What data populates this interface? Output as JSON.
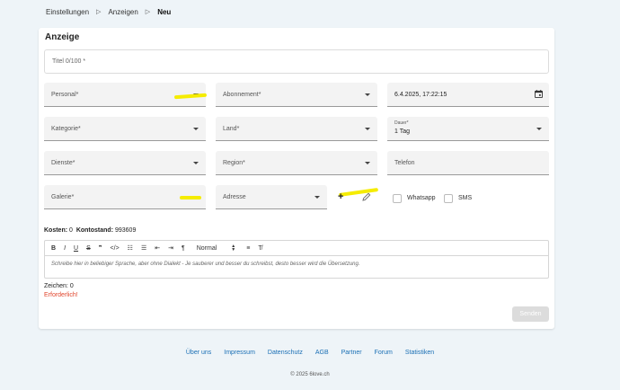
{
  "breadcrumb": {
    "items": [
      "Einstellungen",
      "Anzeigen",
      "Neu"
    ],
    "separator": "▷"
  },
  "card": {
    "title": "Anzeige"
  },
  "form": {
    "title_placeholder": "Titel 0/100 *",
    "personal": "Personal*",
    "abonnement": "Abonnement*",
    "datetime": "6.4.2025, 17:22:15",
    "kategorie": "Kategorie*",
    "land": "Land*",
    "dauer_label": "Dauer*",
    "dauer_value": "1 Tag",
    "dienste": "Dienste*",
    "region": "Region*",
    "telefon": "Telefon",
    "galerie": "Galerie*",
    "adresse": "Adresse",
    "whatsapp": "Whatsapp",
    "sms": "SMS"
  },
  "costs": {
    "kosten_label": "Kosten:",
    "kosten_value": "0",
    "kontostand_label": "Kontostand:",
    "kontostand_value": "993609"
  },
  "editor": {
    "toolbar": {
      "bold": "B",
      "italic": "I",
      "underline": "U",
      "strike": "S",
      "quote": "❞",
      "code": "</>",
      "ordered_list": "☷",
      "bullet_list": "☰",
      "outdent": "⇤",
      "indent": "⇥",
      "pilcrow": "¶",
      "format": "Normal",
      "align": "≡",
      "clear": "T̸"
    },
    "placeholder": "Schreibe hier in beliebiger Sprache, aber ohne Dialekt - Je sauberer und besser du schreibst, desto besser wird die Übersetzung."
  },
  "chars": {
    "label": "Zeichen:",
    "value": "0"
  },
  "required_text": "Erforderlich!",
  "send_label": "Senden",
  "footer": {
    "links": [
      "Über uns",
      "Impressum",
      "Datenschutz",
      "AGB",
      "Partner",
      "Forum",
      "Statistiken"
    ],
    "copyright": "© 2025 6love.ch"
  },
  "colors": {
    "highlight": "#f5ec00",
    "link": "#1a6fb5",
    "error": "#e0452c",
    "background": "#eef4f8"
  }
}
